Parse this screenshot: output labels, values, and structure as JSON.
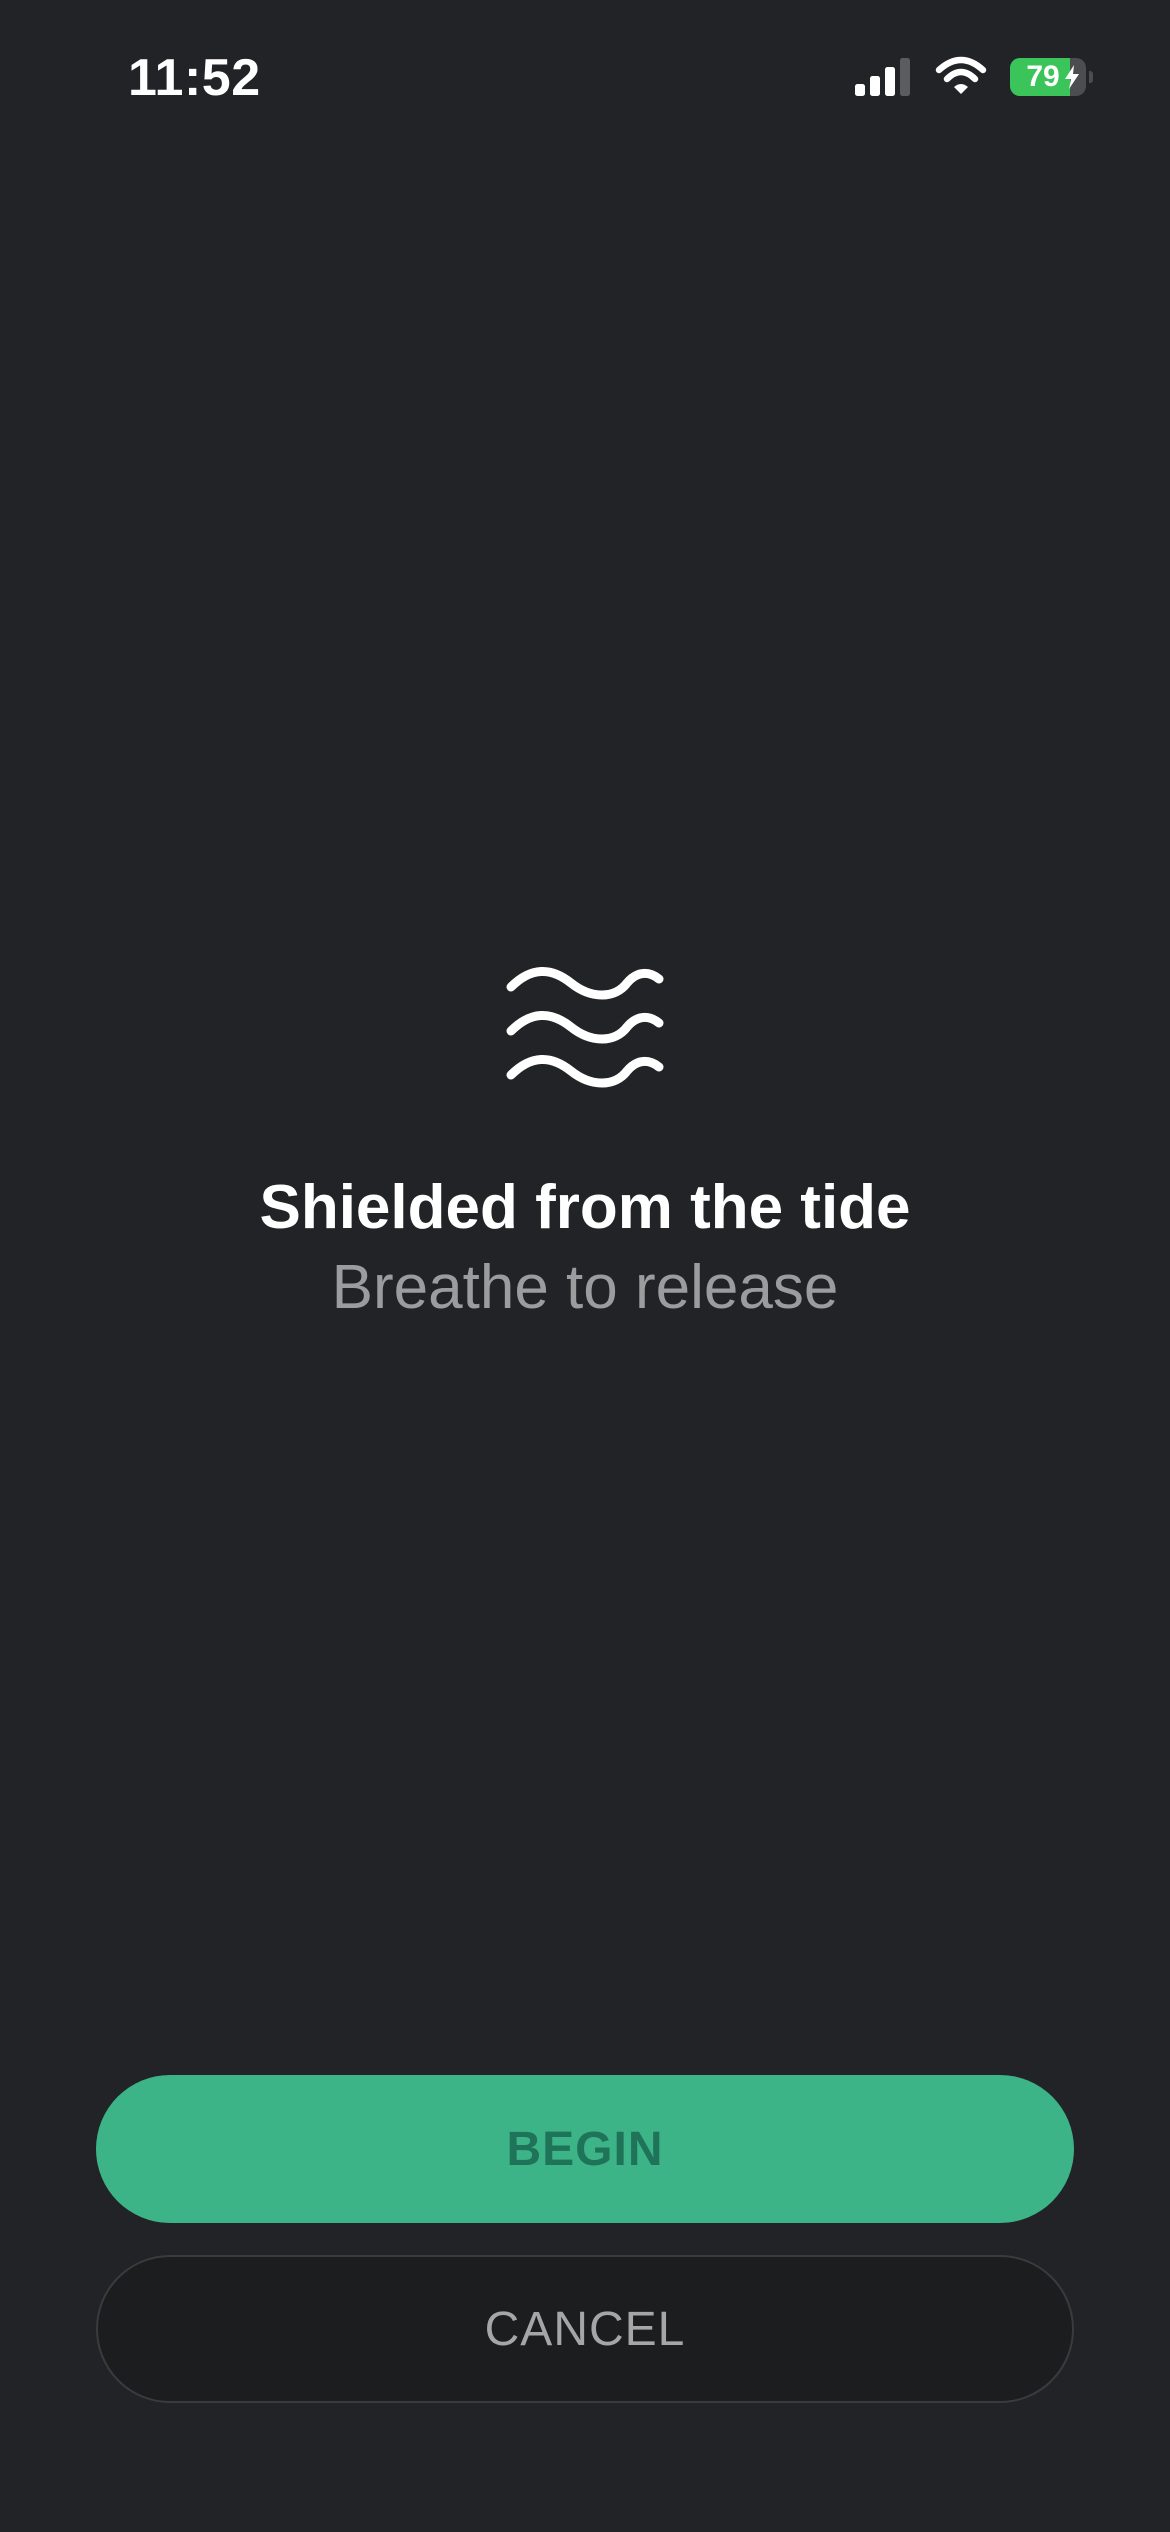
{
  "status_bar": {
    "time": "11:52",
    "battery_percent": 79,
    "battery_text": "79",
    "battery_color": "#3ac45a",
    "icons": [
      "signal-icon",
      "wifi-icon",
      "battery-icon",
      "charging-bolt-icon"
    ]
  },
  "main": {
    "icon": "waves-icon",
    "title": "Shielded from the tide",
    "subtitle": "Breathe to release"
  },
  "actions": {
    "begin_label": "BEGIN",
    "cancel_label": "CANCEL"
  },
  "colors": {
    "background": "#212326",
    "accent": "#3db388",
    "accent_text": "#1f7358",
    "secondary_text": "#9b9c9e"
  }
}
